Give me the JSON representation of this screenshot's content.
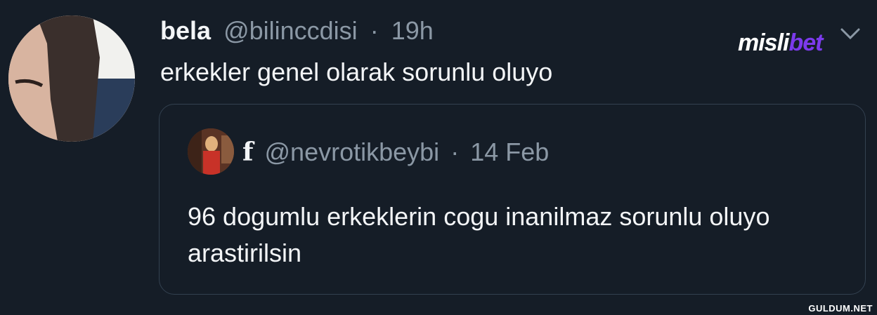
{
  "tweet": {
    "author_name": "bela",
    "handle": "@bilinccdisi",
    "separator": "·",
    "time": "19h",
    "text": "erkekler genel olarak sorunlu oluyo"
  },
  "quoted_tweet": {
    "author_name": "f",
    "handle": "@nevrotikbeybi",
    "separator": "·",
    "date": "14 Feb",
    "text": "96 dogumlu erkeklerin cogu inanilmaz sorunlu oluyo arastirilsin"
  },
  "brand_logo": {
    "text_main": "misli",
    "text_accent": "bet",
    "accent_color": "#7c3aed"
  },
  "watermark": "GULDUM.NET",
  "icons": {
    "menu": "chevron-down-icon"
  }
}
